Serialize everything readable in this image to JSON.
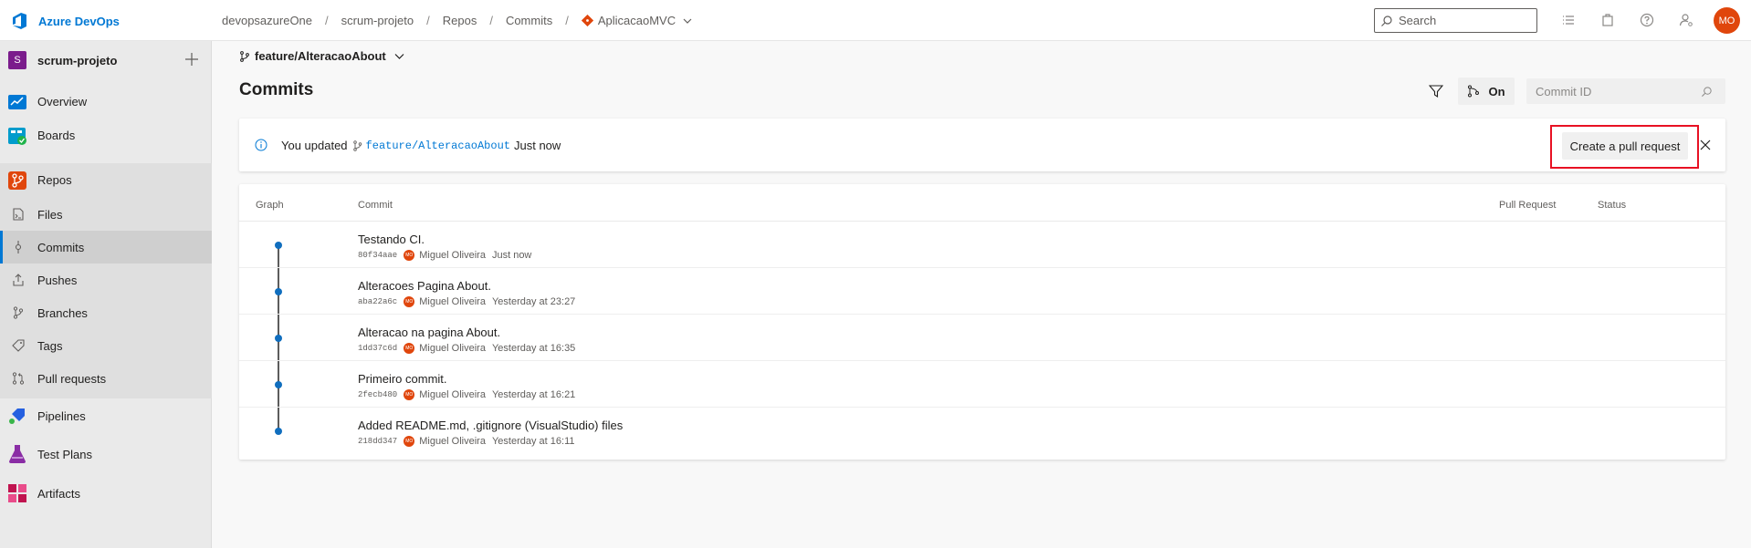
{
  "brand": {
    "name": "Azure DevOps"
  },
  "breadcrumb": {
    "org": "devopsazureOne",
    "project": "scrum-projeto",
    "section": "Repos",
    "page": "Commits",
    "repo": "AplicacaoMVC"
  },
  "search": {
    "placeholder": "Search"
  },
  "user": {
    "initials": "MO"
  },
  "sidebar": {
    "project_initial": "S",
    "project_name": "scrum-projeto",
    "items": [
      {
        "label": "Overview",
        "icon": "overview-icon"
      },
      {
        "label": "Boards",
        "icon": "boards-icon"
      },
      {
        "label": "Repos",
        "icon": "repos-icon"
      },
      {
        "label": "Files",
        "icon": "files-icon"
      },
      {
        "label": "Commits",
        "icon": "commits-icon",
        "selected": true
      },
      {
        "label": "Pushes",
        "icon": "pushes-icon"
      },
      {
        "label": "Branches",
        "icon": "branches-icon"
      },
      {
        "label": "Tags",
        "icon": "tags-icon"
      },
      {
        "label": "Pull requests",
        "icon": "pull-requests-icon"
      },
      {
        "label": "Pipelines",
        "icon": "pipelines-icon"
      },
      {
        "label": "Test Plans",
        "icon": "test-plans-icon"
      },
      {
        "label": "Artifacts",
        "icon": "artifacts-icon"
      }
    ]
  },
  "main": {
    "branch": "feature/AlteracaoAbout",
    "title": "Commits",
    "graph_toggle": "On",
    "commit_id_placeholder": "Commit ID"
  },
  "banner": {
    "prefix": "You updated",
    "branch": "feature/AlteracaoAbout",
    "suffix": "Just now",
    "button": "Create a pull request"
  },
  "table": {
    "columns": [
      "Graph",
      "Commit",
      "Pull Request",
      "Status"
    ],
    "rows": [
      {
        "message": "Testando CI.",
        "hash": "80f34aae",
        "author_initials": "MO",
        "author": "Miguel Oliveira",
        "time": "Just now"
      },
      {
        "message": "Alteracoes Pagina About.",
        "hash": "aba22a6c",
        "author_initials": "MO",
        "author": "Miguel Oliveira",
        "time": "Yesterday at 23:27"
      },
      {
        "message": "Alteracao na pagina About.",
        "hash": "1dd37c6d",
        "author_initials": "MO",
        "author": "Miguel Oliveira",
        "time": "Yesterday at 16:35"
      },
      {
        "message": "Primeiro commit.",
        "hash": "2fecb480",
        "author_initials": "MO",
        "author": "Miguel Oliveira",
        "time": "Yesterday at 16:21"
      },
      {
        "message": "Added README.md, .gitignore (VisualStudio) files",
        "hash": "218dd347",
        "author_initials": "MO",
        "author": "Miguel Oliveira",
        "time": "Yesterday at 16:11"
      }
    ]
  },
  "colors": {
    "accent": "#0078d4",
    "avatar": "#e0460c",
    "highlight": "#e81123",
    "project_badge": "#7b1c8c"
  }
}
